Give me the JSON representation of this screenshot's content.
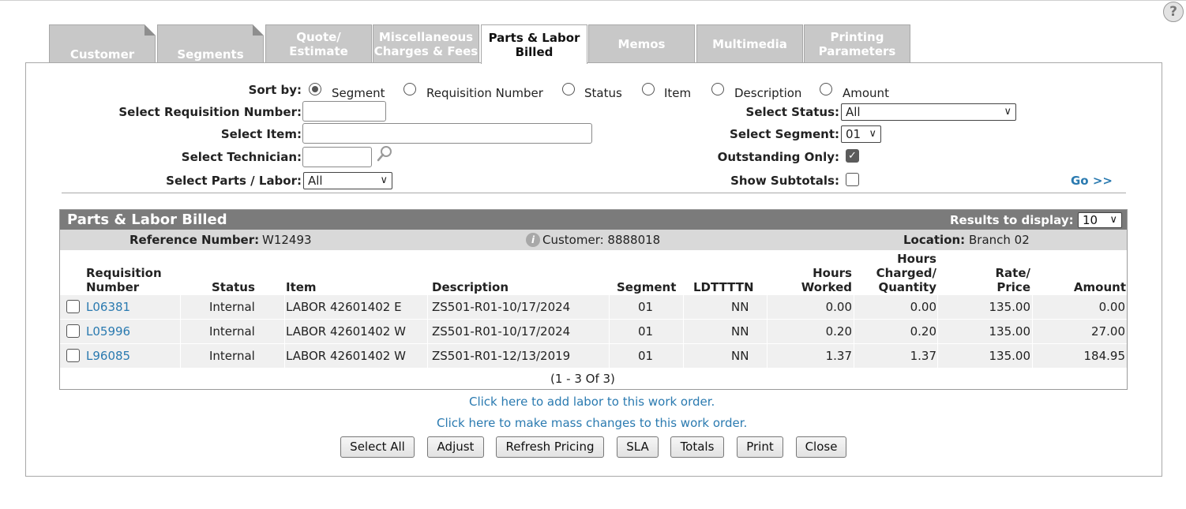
{
  "help": {
    "glyph": "?"
  },
  "tabs": [
    {
      "label": "Customer"
    },
    {
      "label": "Segments"
    },
    {
      "label": "Quote/\nEstimate"
    },
    {
      "label": "Miscellaneous\nCharges & Fees"
    },
    {
      "label": "Parts & Labor\nBilled",
      "active": true
    },
    {
      "label": "Memos"
    },
    {
      "label": "Multimedia"
    },
    {
      "label": "Printing\nParameters"
    }
  ],
  "filters": {
    "sort_by_label": "Sort by:",
    "sort_options": [
      {
        "label": "Segment",
        "selected": true
      },
      {
        "label": "Requisition Number",
        "selected": false
      },
      {
        "label": "Status",
        "selected": false
      },
      {
        "label": "Item",
        "selected": false
      },
      {
        "label": "Description",
        "selected": false
      },
      {
        "label": "Amount",
        "selected": false
      }
    ],
    "requisition_label": "Select Requisition Number:",
    "requisition_value": "",
    "item_label": "Select Item:",
    "item_value": "",
    "technician_label": "Select Technician:",
    "technician_value": "",
    "parts_labor_label": "Select Parts / Labor:",
    "parts_labor_value": "All",
    "status_label": "Select Status:",
    "status_value": "All",
    "segment_label": "Select Segment:",
    "segment_value": "01",
    "outstanding_label": "Outstanding Only:",
    "outstanding_checked": true,
    "subtotals_label": "Show Subtotals:",
    "subtotals_checked": false,
    "go_label": "Go >>"
  },
  "grid": {
    "title": "Parts & Labor Billed",
    "results_label": "Results to display:",
    "results_value": "10",
    "reference_label": "Reference Number:",
    "reference_value": "W12493",
    "customer_text": "Customer: 8888018",
    "location_label": "Location:",
    "location_value": "Branch 02",
    "columns": {
      "req": "Requisition\nNumber",
      "status": "Status",
      "item": "Item",
      "description": "Description",
      "segment": "Segment",
      "ldtttn": "LDTTTTN",
      "hours_worked": "Hours\nWorked",
      "hours_charged": "Hours\nCharged/\nQuantity",
      "rate": "Rate/\nPrice",
      "amount": "Amount"
    },
    "rows": [
      {
        "req": "L06381",
        "status": "Internal",
        "item": "LABOR 42601402 E",
        "description": "ZS501-R01-10/17/2024",
        "segment": "01",
        "ldtttn": "NN",
        "hours_worked": "0.00",
        "hours_charged": "0.00",
        "rate": "135.00",
        "amount": "0.00"
      },
      {
        "req": "L05996",
        "status": "Internal",
        "item": "LABOR 42601402 W",
        "description": "ZS501-R01-10/17/2024",
        "segment": "01",
        "ldtttn": "NN",
        "hours_worked": "0.20",
        "hours_charged": "0.20",
        "rate": "135.00",
        "amount": "27.00"
      },
      {
        "req": "L96085",
        "status": "Internal",
        "item": "LABOR 42601402 W",
        "description": "ZS501-R01-12/13/2019",
        "segment": "01",
        "ldtttn": "NN",
        "hours_worked": "1.37",
        "hours_charged": "1.37",
        "rate": "135.00",
        "amount": "184.95"
      }
    ],
    "pagination": "(1 - 3 Of 3)"
  },
  "links": {
    "add_labor": "Click here to add labor to this work order.",
    "mass_changes": "Click here to make mass changes to this work order."
  },
  "buttons": {
    "select_all": "Select All",
    "adjust": "Adjust",
    "refresh_pricing": "Refresh Pricing",
    "sla": "SLA",
    "totals": "Totals",
    "print": "Print",
    "close": "Close"
  },
  "colors": {
    "link": "#2a7ab0",
    "tab_inactive": "#c8c8c8",
    "grid_header": "#7b7b7b",
    "grid_info": "#d9d9d9",
    "row_bg": "#f0f0f0"
  }
}
